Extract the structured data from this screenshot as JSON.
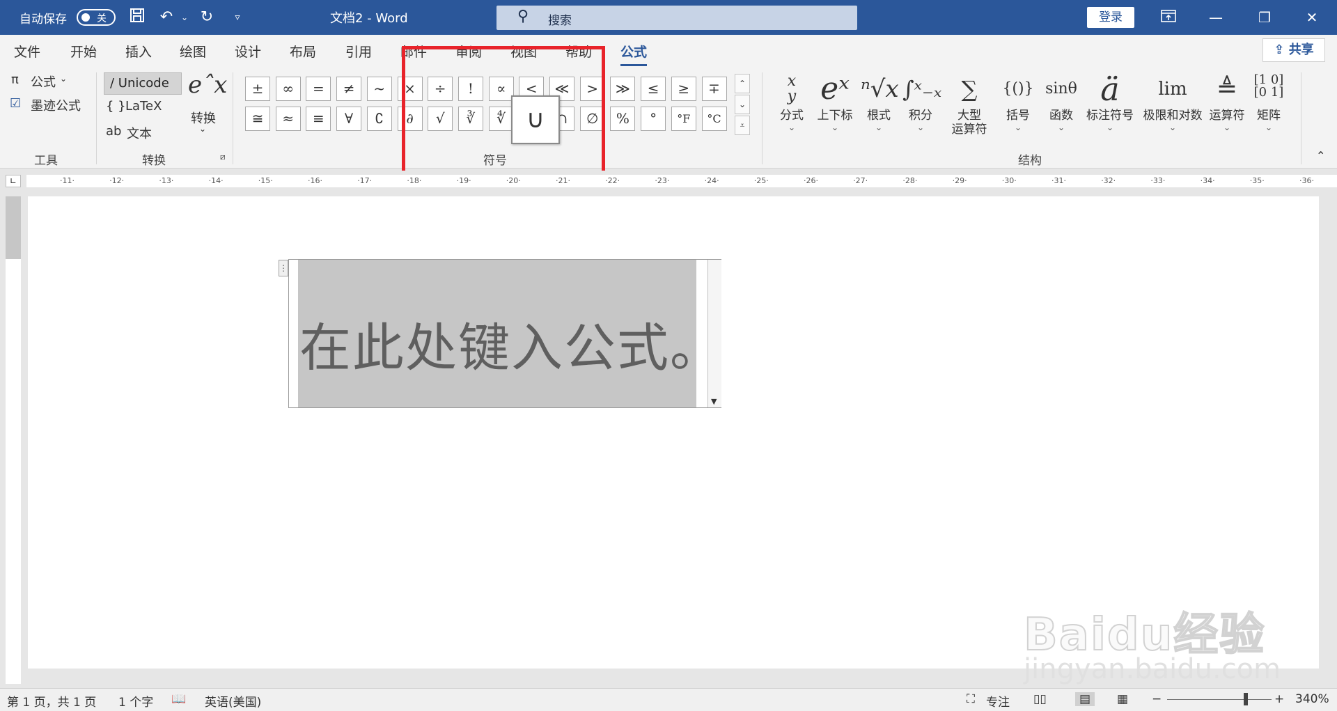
{
  "titlebar": {
    "autosave_label": "自动保存",
    "autosave_state": "关",
    "doc_title": "文档2  -  Word",
    "search_placeholder": "搜索",
    "login_label": "登录"
  },
  "tabs": [
    "文件",
    "开始",
    "插入",
    "绘图",
    "设计",
    "布局",
    "引用",
    "邮件",
    "审阅",
    "视图",
    "帮助",
    "公式"
  ],
  "active_tab": "公式",
  "share_label": "共享",
  "ribbon": {
    "tools": {
      "formula_label": "公式",
      "ink_formula_label": "墨迹公式",
      "group_label": "工具"
    },
    "convert": {
      "unicode_label": "Unicode",
      "latex_label": "LaTeX",
      "text_label": "文本",
      "convert_label": "转换",
      "group_label": "转换"
    },
    "symbols": {
      "row1": [
        "±",
        "∞",
        "=",
        "≠",
        "~",
        "×",
        "÷",
        "!",
        "∝",
        "<",
        "≪",
        ">",
        "≫",
        "≤",
        "≥",
        "∓"
      ],
      "row2": [
        "≅",
        "≈",
        "≡",
        "∀",
        "∁",
        "∂",
        "√",
        "∛",
        "∜",
        "∪",
        "∩",
        "∅",
        "%",
        "°",
        "°F",
        "°C"
      ],
      "group_label": "符号",
      "tooltip_symbol": "∪"
    },
    "structures": {
      "items": [
        {
          "label": "分式",
          "glyph": "x/y"
        },
        {
          "label": "上下标",
          "glyph": "eˣ"
        },
        {
          "label": "根式",
          "glyph": "ⁿ√x"
        },
        {
          "label": "积分",
          "glyph": "∫"
        },
        {
          "label": "大型\n运算符",
          "glyph": "∑"
        },
        {
          "label": "括号",
          "glyph": "{()}"
        },
        {
          "label": "函数",
          "glyph": "sinθ"
        },
        {
          "label": "标注符号",
          "glyph": "ä"
        },
        {
          "label": "极限和对数",
          "glyph": "lim"
        },
        {
          "label": "运算符",
          "glyph": "≜"
        },
        {
          "label": "矩阵",
          "glyph": "[10;01]"
        }
      ],
      "large_op_line1": "大型",
      "large_op_line2": "运算符",
      "group_label": "结构"
    }
  },
  "ruler_ticks": [
    "11",
    "12",
    "13",
    "14",
    "15",
    "16",
    "17",
    "18",
    "19",
    "20",
    "21",
    "22",
    "23",
    "24",
    "25",
    "26",
    "27",
    "28",
    "29",
    "30",
    "31",
    "32",
    "33",
    "34",
    "35",
    "36"
  ],
  "document": {
    "equation_placeholder": "在此处键入公式。"
  },
  "watermark": {
    "main": "Baidu经验",
    "sub": "jingyan.baidu.com"
  },
  "statusbar": {
    "page_info": "第 1 页，共 1 页",
    "word_count": "1 个字",
    "language": "英语(美国)",
    "focus_label": "专注",
    "zoom": "340%"
  },
  "colors": {
    "title_bar": "#2b579a",
    "highlight_box": "#e8232a"
  }
}
